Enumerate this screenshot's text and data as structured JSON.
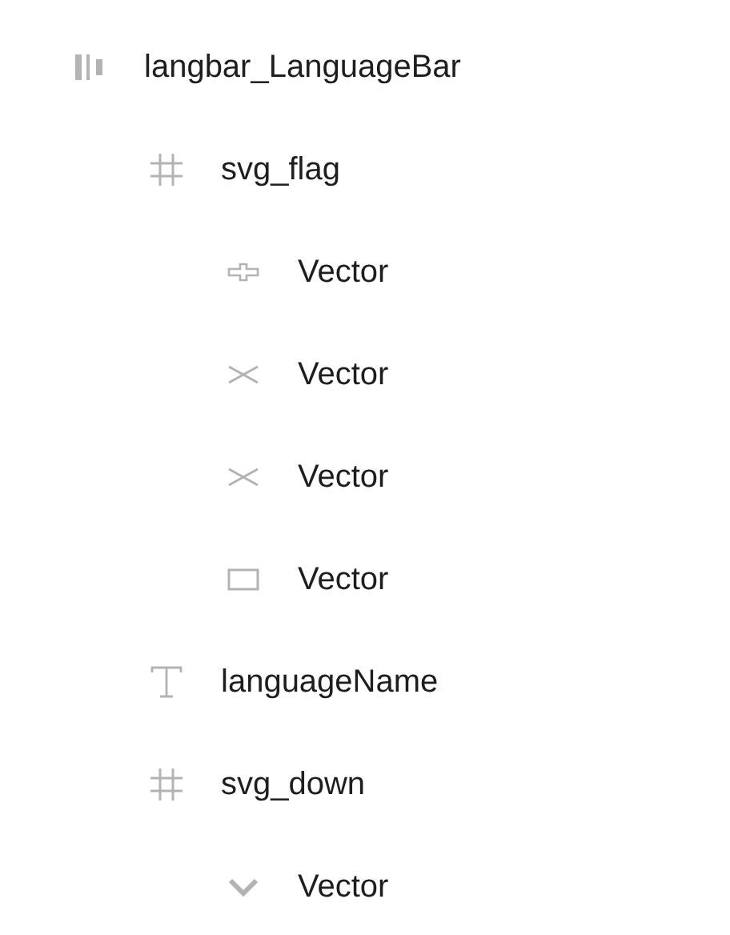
{
  "layers": [
    {
      "kind": "autolayout",
      "name": "langbar_LanguageBar",
      "children": [
        {
          "kind": "frame",
          "name": "svg_flag",
          "children": [
            {
              "kind": "vector-plus",
              "name": "Vector"
            },
            {
              "kind": "vector-cross",
              "name": "Vector"
            },
            {
              "kind": "vector-cross",
              "name": "Vector"
            },
            {
              "kind": "vector-rect",
              "name": "Vector"
            }
          ]
        },
        {
          "kind": "text",
          "name": "languageName"
        },
        {
          "kind": "frame",
          "name": "svg_down",
          "children": [
            {
              "kind": "vector-chevron",
              "name": "Vector"
            }
          ]
        }
      ]
    }
  ]
}
